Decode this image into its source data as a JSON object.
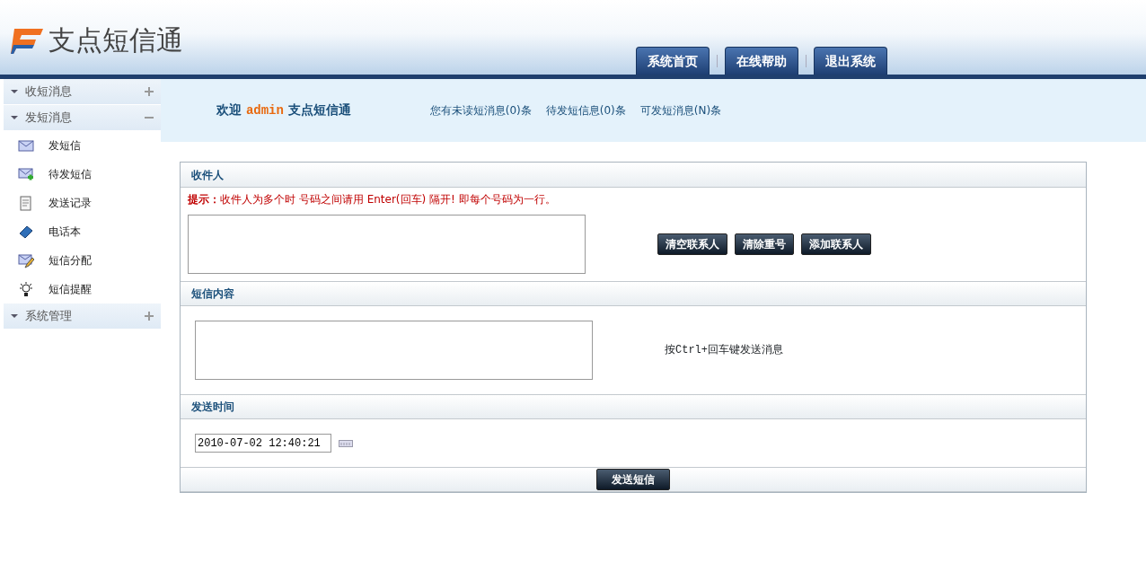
{
  "header": {
    "logo": "支点短信通",
    "nav": [
      "系统首页",
      "在线帮助",
      "退出系统"
    ]
  },
  "sidebar": {
    "groups": [
      {
        "label": "收短消息",
        "expanded": false
      },
      {
        "label": "发短消息",
        "expanded": true,
        "items": [
          {
            "label": "发短信"
          },
          {
            "label": "待发短信"
          },
          {
            "label": "发送记录"
          },
          {
            "label": "电话本"
          },
          {
            "label": "短信分配"
          },
          {
            "label": "短信提醒"
          }
        ]
      },
      {
        "label": "系统管理",
        "expanded": false
      }
    ]
  },
  "welcome": {
    "prefix": "欢迎",
    "user": "admin",
    "suffix": "支点短信通",
    "stats": [
      "您有未读短消息(0)条",
      "待发短信息(0)条",
      "可发短消息(N)条"
    ]
  },
  "form": {
    "sections": [
      {
        "title": "收件人",
        "kind": "recipients",
        "hint_label": "提示：",
        "hint": "收件人为多个时 号码之间请用 Enter(回车) 隔开! 即每个号码为一行。",
        "buttons": [
          "清空联系人",
          "清除重号",
          "添加联系人"
        ]
      },
      {
        "title": "短信内容",
        "kind": "content",
        "note": "按Ctrl+回车键发送消息"
      },
      {
        "title": "发送时间",
        "kind": "time",
        "value": "2010-07-02 12:40:21"
      }
    ],
    "submit": "发送短信"
  }
}
